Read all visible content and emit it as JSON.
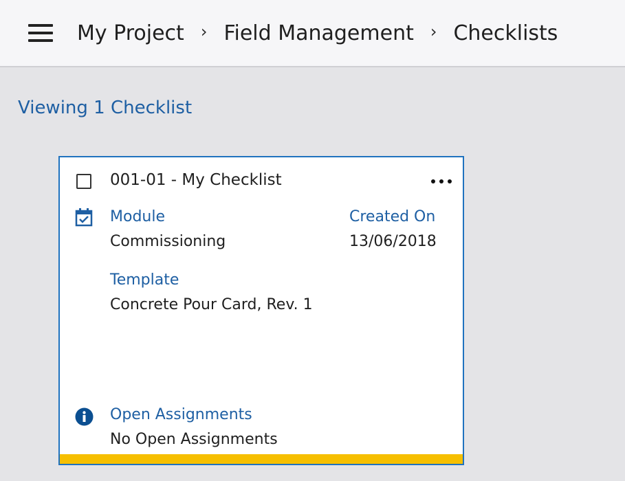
{
  "header": {
    "menu_icon": "hamburger-menu-icon",
    "breadcrumbs": [
      {
        "label": "My Project"
      },
      {
        "label": "Field Management"
      },
      {
        "label": "Checklists"
      }
    ],
    "separator_icon": "chevron-right-icon"
  },
  "summary": {
    "viewing_text": "Viewing 1 Checklist"
  },
  "checklist_card": {
    "title": "001-01 - My Checklist",
    "more_icon": "more-horizontal-icon",
    "module_icon": "calendar-check-icon",
    "module_label": "Module",
    "module_value": "Commissioning",
    "created_on_label": "Created On",
    "created_on_value": "13/06/2018",
    "template_label": "Template",
    "template_value": "Concrete Pour Card, Rev. 1",
    "assignments_icon": "info-icon",
    "assignments_label": "Open Assignments",
    "assignments_value": "No Open Assignments"
  },
  "colors": {
    "link_blue": "#1e5fa3",
    "card_border": "#1f72bf",
    "status_bar": "#f6bf00",
    "info_circle": "#0b4f91",
    "page_background": "#e4e4e7",
    "header_background": "#f6f6f8"
  }
}
